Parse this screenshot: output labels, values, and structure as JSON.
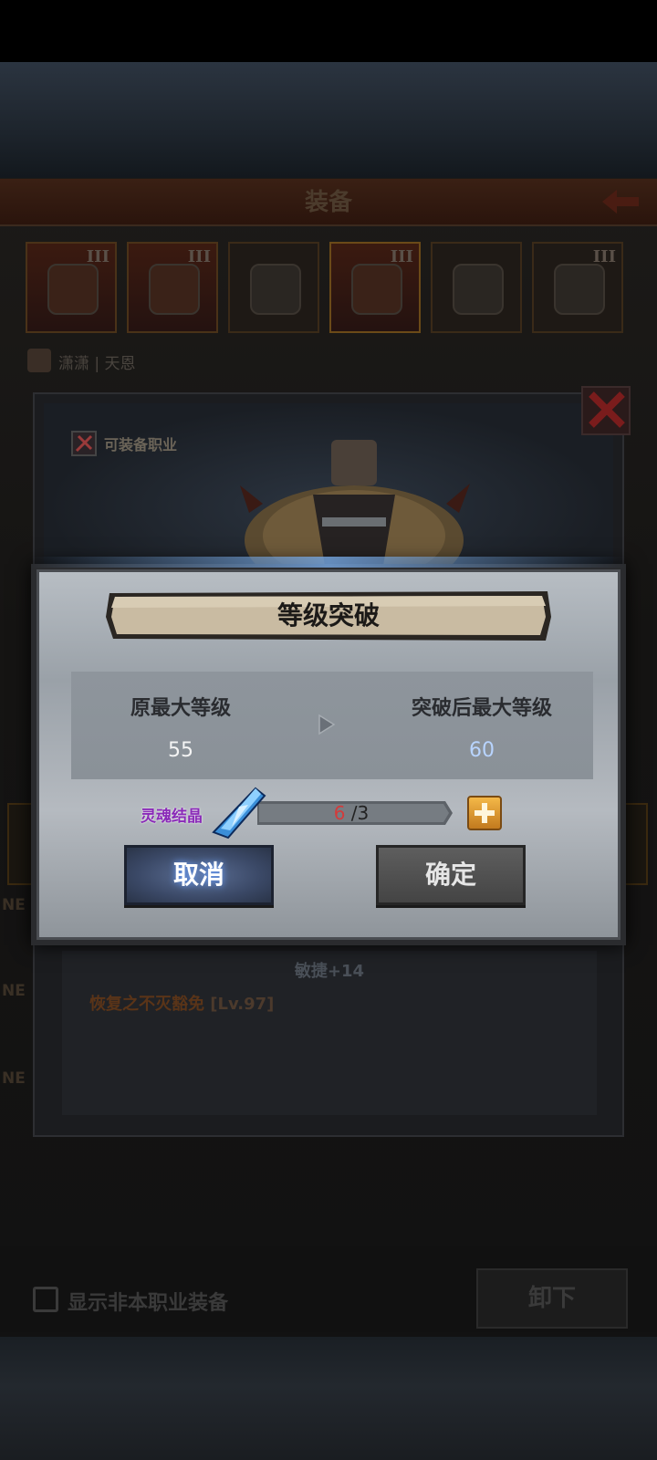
{
  "background": {
    "screen_title": "装备",
    "slots": [
      {
        "tier": "III",
        "rarity": "red"
      },
      {
        "tier": "III",
        "rarity": "red"
      },
      {
        "tier": "",
        "rarity": "gray"
      },
      {
        "tier": "III",
        "rarity": "red"
      },
      {
        "tier": "",
        "rarity": "gray"
      },
      {
        "tier": "III",
        "rarity": "gray"
      }
    ],
    "character_name": "潇潇 | 天恩",
    "side_label_1": "NE",
    "side_label_2": "NE",
    "side_label_3": "NE",
    "show_non_class_label": "显示非本职业装备",
    "unequip_label": "卸下"
  },
  "detail": {
    "job_label": "可装备职业",
    "stat_agility": "敏捷+14",
    "skill_name": "恢复之不灭豁免",
    "skill_level": "[Lv.97]"
  },
  "dialog": {
    "title": "等级突破",
    "old_max_label": "原最大等级",
    "old_max_value": "55",
    "new_max_label": "突破后最大等级",
    "new_max_value": "60",
    "material_name": "灵魂结晶",
    "material_have": "6",
    "material_sep": "/",
    "material_need": "3",
    "cancel_label": "取消",
    "confirm_label": "确定"
  },
  "colors": {
    "material_name": "#8a2ab8",
    "have_count": "#d33b3b",
    "new_value": "#b8d4ff",
    "cancel_button": "#3b4967",
    "confirm_button": "#4e4e4e"
  }
}
